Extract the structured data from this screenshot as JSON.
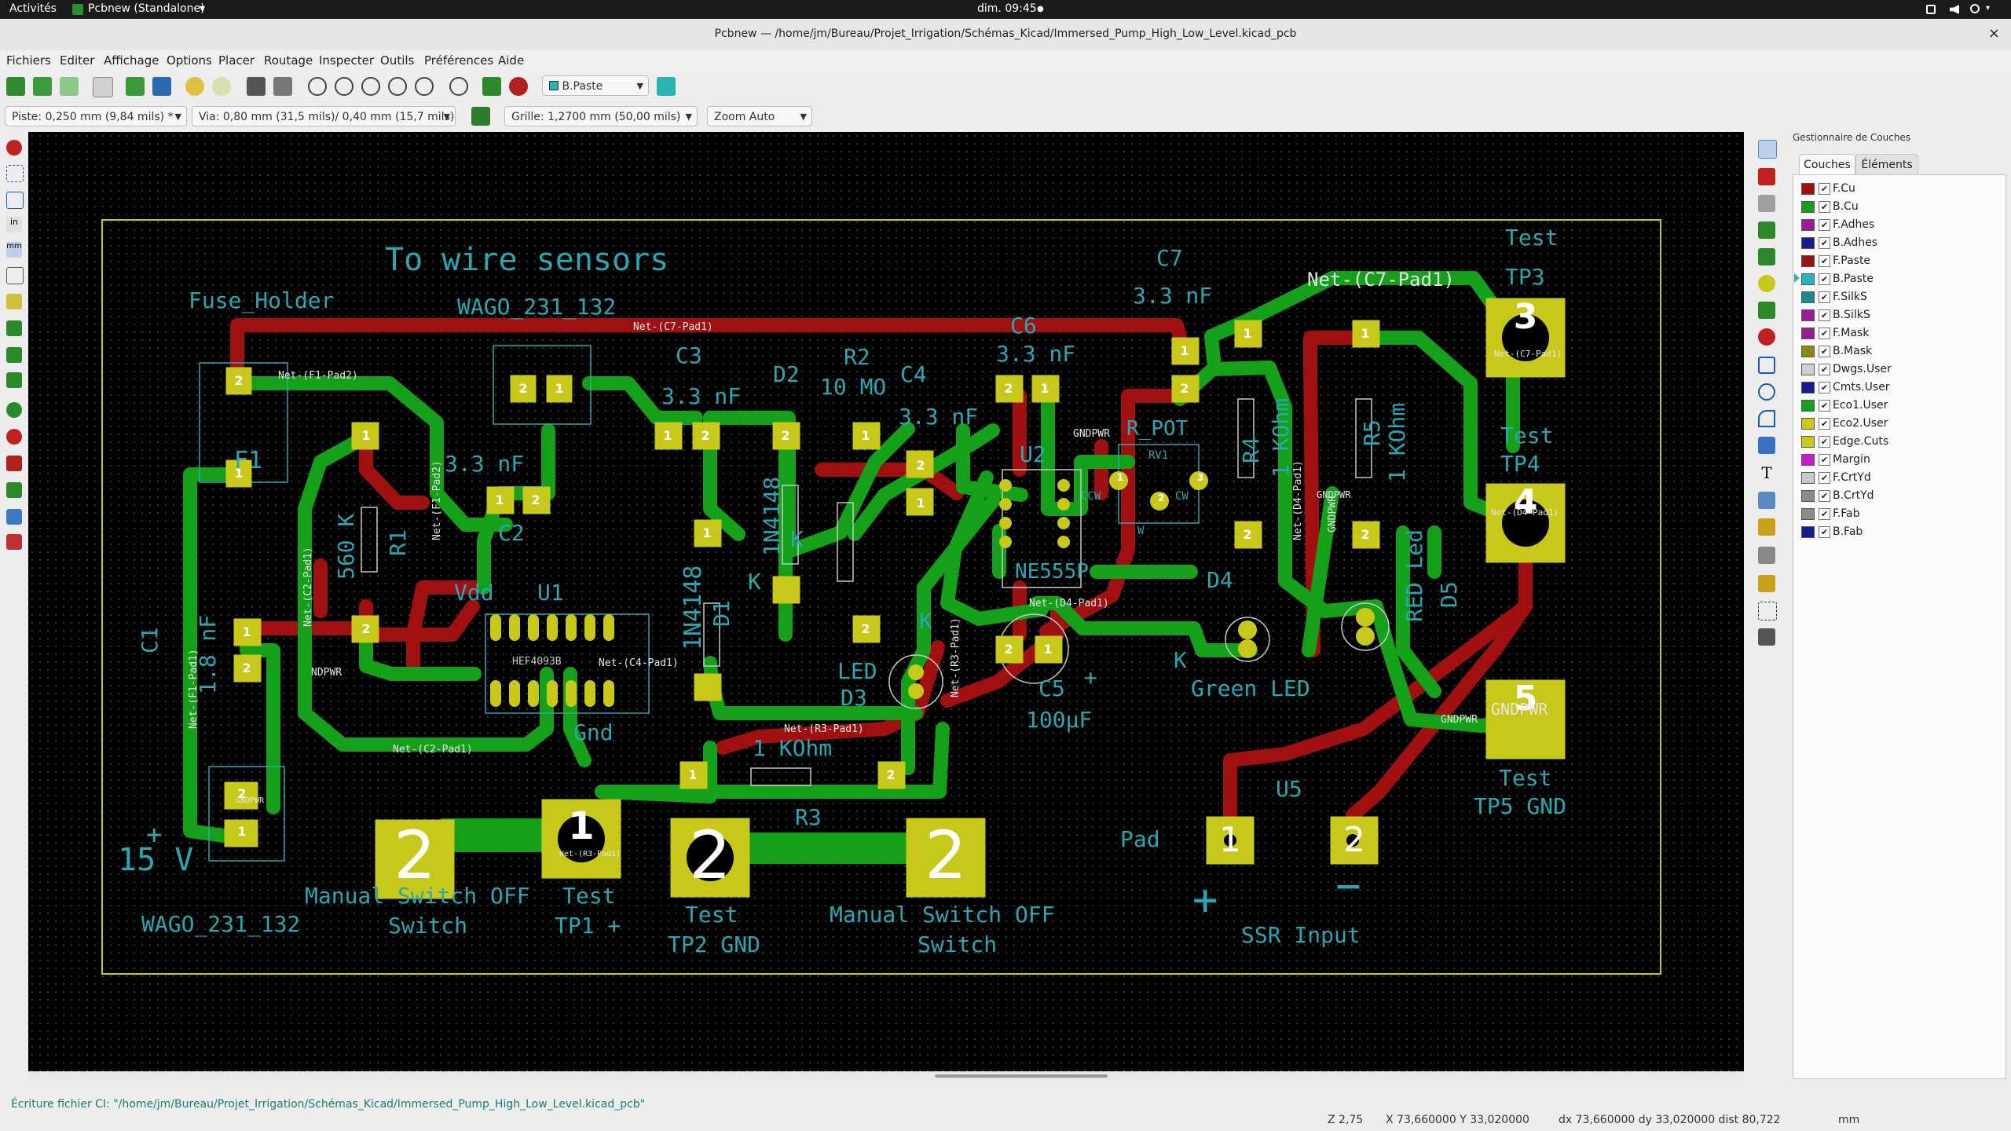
{
  "topbar": {
    "activities": "Activités",
    "app": "Pcbnew (Standalone)",
    "app_arrow": "▾",
    "clock": "dim. 09:45",
    "clock_dot": "●",
    "tray_icons": [
      "network-icon",
      "volume-icon",
      "power-icon"
    ]
  },
  "window": {
    "title": "Pcbnew — /home/jm/Bureau/Projet_Irrigation/Schémas_Kicad/Immersed_Pump_High_Low_Level.kicad_pcb",
    "close": "×"
  },
  "menu": [
    "Fichiers",
    "Editer",
    "Affichage",
    "Options",
    "Placer",
    "Routage",
    "Inspecter",
    "Outils",
    "Préférences",
    "Aide"
  ],
  "toolbar": {
    "active_layer": "B.Paste",
    "active_layer_color": "#2ab3b5"
  },
  "aux": {
    "track": "Piste: 0,250 mm (9,84 mils) *",
    "via": "Via: 0,80 mm (31,5 mils)/ 0,40 mm (15,7 mils) *",
    "grid": "Grille: 1,2700 mm (50,00 mils)",
    "zoom": "Zoom Auto"
  },
  "panel": {
    "title": "Gestionnaire de Couches",
    "tabs": [
      "Couches",
      "Éléments"
    ],
    "layers": [
      {
        "name": "F.Cu",
        "color": "#a01010",
        "checked": "✔"
      },
      {
        "name": "B.Cu",
        "color": "#15a01a",
        "checked": "✔"
      },
      {
        "name": "F.Adhes",
        "color": "#9a1a9a",
        "checked": "✔"
      },
      {
        "name": "B.Adhes",
        "color": "#1a1a90",
        "checked": "✔"
      },
      {
        "name": "F.Paste",
        "color": "#9a1414",
        "checked": "✔"
      },
      {
        "name": "B.Paste",
        "color": "#2ab3b5",
        "checked": "✔"
      },
      {
        "name": "F.SilkS",
        "color": "#1a8a8a",
        "checked": "✔"
      },
      {
        "name": "B.SilkS",
        "color": "#9a1a9a",
        "checked": "✔"
      },
      {
        "name": "F.Mask",
        "color": "#9a1a9a",
        "checked": "✔"
      },
      {
        "name": "B.Mask",
        "color": "#8a8a10",
        "checked": "✔"
      },
      {
        "name": "Dwgs.User",
        "color": "#d0d0d0",
        "checked": "✔"
      },
      {
        "name": "Cmts.User",
        "color": "#1a1a90",
        "checked": "✔"
      },
      {
        "name": "Eco1.User",
        "color": "#15a01a",
        "checked": "✔"
      },
      {
        "name": "Eco2.User",
        "color": "#c8c81a",
        "checked": "✔"
      },
      {
        "name": "Edge.Cuts",
        "color": "#c8c81a",
        "checked": "✔"
      },
      {
        "name": "Margin",
        "color": "#c81ac8",
        "checked": "✔"
      },
      {
        "name": "F.CrtYd",
        "color": "#c8c8c8",
        "checked": "✔"
      },
      {
        "name": "B.CrtYd",
        "color": "#8a8a8a",
        "checked": "✔"
      },
      {
        "name": "F.Fab",
        "color": "#8a8a8a",
        "checked": "✔"
      },
      {
        "name": "B.Fab",
        "color": "#1a1a90",
        "checked": "✔"
      }
    ]
  },
  "pcb": {
    "silk": {
      "wire_sensors": "To  wire sensors",
      "fuse_holder": "Fuse_Holder",
      "wago1": "WAGO_231_132",
      "f1": "F1",
      "c1": "C1",
      "c1val": "1.8 nF",
      "r1": "R1",
      "r1val": "560 K",
      "c2": "C2",
      "c2val": "3.3 nF",
      "vdd": "Vdd",
      "u1": "U1",
      "gnd": "Gnd",
      "c3": "C3",
      "c3val": "3.3 nF",
      "d2": "D2",
      "r2": "R2",
      "r2val": "10 MO",
      "c4": "C4",
      "c4val": "3.3 nF",
      "d1": "D1",
      "d1val": "1N4148",
      "d2val": "1N4148",
      "k1": "K",
      "k2": "K",
      "led_d3": "LED",
      "d3": "D3",
      "k3": "K",
      "c6": "C6",
      "c6val": "3.3 nF",
      "u2": "U2",
      "ne555": "NE555P",
      "rpot": "R_POT",
      "c5": "C5",
      "c5val": "100µF",
      "c5plus": "+",
      "c7": "C7",
      "c7val": "3.3 nF",
      "r4": "R4",
      "r4val": "1 KOhm",
      "r5": "R5",
      "r5val": "1 KOhm",
      "d4": "D4",
      "k4": "K",
      "green_led": "Green LED",
      "red_led": "RED Led",
      "d5": "D5",
      "r3": "R3",
      "r3val": "1 KOhm",
      "v15": "15 V",
      "plus15": "+",
      "wago2": "WAGO_231_132",
      "msw1": "Manual Switch OFF",
      "sw1": "Switch",
      "tp1": "Test",
      "tp1b": "TP1 +",
      "tp2": "Test",
      "tp2b": "TP2 GND",
      "msw2": "Manual  Switch OFF",
      "sw2": "Switch",
      "pad": "Pad",
      "u5": "U5",
      "ssr": "SSR Input",
      "plus_ssr": "+",
      "minus_ssr": "−",
      "tp3": "Test",
      "tp3b": "TP3",
      "tp4": "Test",
      "tp4b": "TP4",
      "tp5": "Test",
      "tp5b": "TP5 GND",
      "gndpwr_lbl": "GNDPWR",
      "hef": "HEF4093B",
      "rv1": "RV1",
      "ccw": "CCW",
      "cw": "CW",
      "w": "W"
    },
    "nets": {
      "c7pad1_top": "Net-(C7-Pad1)",
      "c7pad1_big": "Net-(C7-Pad1)",
      "f1pad2": "Net-(F1-Pad2)",
      "f1pad2_v": "Net-(F1-Pad2)",
      "c2pad1": "Net-(C2-Pad1)",
      "c2pad1_b": "Net-(C2-Pad1)",
      "f1pad1": "Net-(F1-Pad1)",
      "c4pad1": "Net-(C4-Pad1)",
      "d4pad1": "Net-(D4-Pad1)",
      "d4pad1_v": "Net-(D4-Pad1)",
      "r3pad1": "Net-(R3-Pad1)",
      "r3pad1_v": "Net-(R3-Pad1)",
      "gndpwr1": "GNDPWR",
      "gndpwr2": "GNDPWR",
      "gndpwr3": "GNDPWR",
      "gndpwr4": "GNDPWR",
      "gndpwr5": "GNDPWR",
      "ndpwr": "NDPWR"
    },
    "pads": {
      "p1": "1",
      "p2": "2",
      "p3": "3",
      "p4": "4",
      "p5": "5"
    }
  },
  "status": {
    "message": "Écriture fichier CI: \"/home/jm/Bureau/Projet_Irrigation/Schémas_Kicad/Immersed_Pump_High_Low_Level.kicad_pcb\"",
    "zoom": "Z 2,75",
    "xy": "X 73,660000  Y 33,020000",
    "delta": "dx 73,660000  dy 33,020000  dist 80,722",
    "units": "mm"
  }
}
